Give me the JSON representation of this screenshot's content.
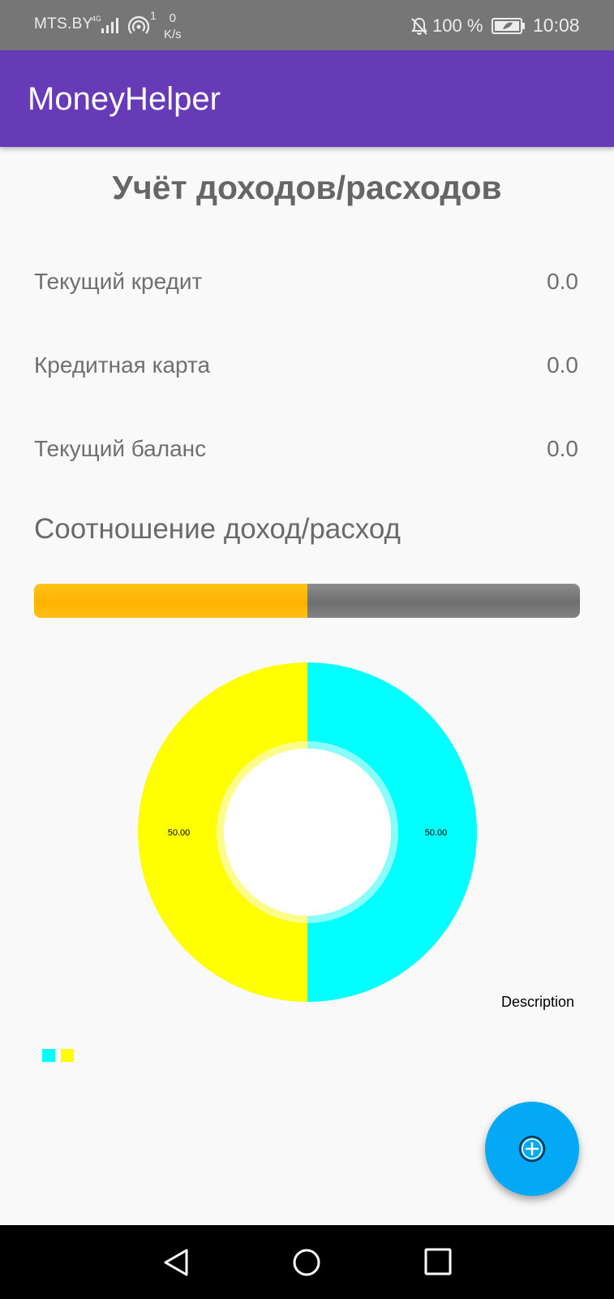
{
  "status_bar": {
    "carrier": "MTS.BY",
    "network_type": "4G",
    "hotspot_count": "1",
    "net_speed_value": "0",
    "net_speed_unit": "K/s",
    "battery": "100 %",
    "time": "10:08",
    "icons": [
      "signal-icon",
      "hotspot-icon",
      "bell-off-icon",
      "battery-saver-icon"
    ]
  },
  "app_bar": {
    "title": "MoneyHelper"
  },
  "main": {
    "heading": "Учёт доходов/расходов",
    "rows": [
      {
        "label": "Текущий кредит",
        "value": "0.0"
      },
      {
        "label": "Кредитная карта",
        "value": "0.0"
      },
      {
        "label": "Текущий баланс",
        "value": "0.0"
      }
    ],
    "ratio_title": "Соотношение доход/расход",
    "progress": {
      "value": 0.5,
      "fill_color": "#ffb300",
      "track_color": "#767676"
    }
  },
  "chart_data": {
    "type": "pie",
    "variant": "donut",
    "slices": [
      {
        "value": 50,
        "label": "50.00",
        "color": "#00ffff"
      },
      {
        "value": 50,
        "label": "50.00",
        "color": "#ffff00"
      }
    ],
    "description": "Description",
    "legend": {
      "placement": "bottom-left",
      "entries": [
        "",
        ""
      ],
      "colors": [
        "#00ffff",
        "#ffff00"
      ]
    }
  },
  "fab": {
    "icon": "add-circle-icon",
    "color": "#03a9f4"
  },
  "nav_bar": {
    "buttons": [
      "back-icon",
      "home-icon",
      "recents-icon"
    ]
  }
}
